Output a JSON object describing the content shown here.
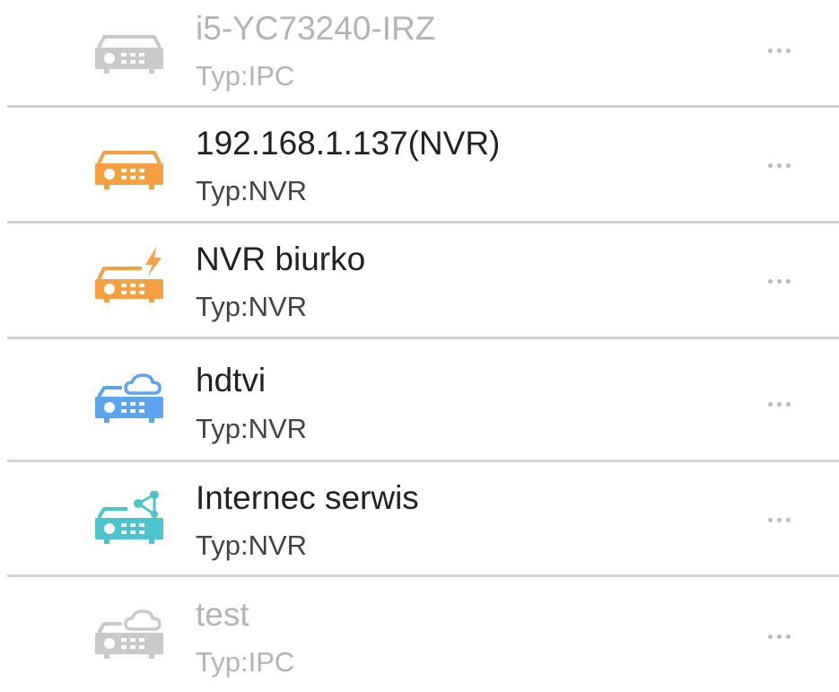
{
  "colors": {
    "active_text": "#222222",
    "type_text": "#444444",
    "inactive_text": "#b4b4b4",
    "inactive_icon": "#c9c9c9",
    "nvr_orange": "#f7a042",
    "cloud_blue": "#5aa5ee",
    "share_teal": "#4cc4cf",
    "divider": "#d2d2d2"
  },
  "devices": [
    {
      "name": "i5-YC73240-IRZ",
      "type": "Typ:IPC",
      "icon": "dvr-gray-icon",
      "state": "inactive"
    },
    {
      "name": "192.168.1.137(NVR)",
      "type": "Typ:NVR",
      "icon": "dvr-orange-icon",
      "state": "active"
    },
    {
      "name": "NVR biurko",
      "type": "Typ:NVR",
      "icon": "dvr-lightning-icon",
      "state": "active"
    },
    {
      "name": "hdtvi",
      "type": "Typ:NVR",
      "icon": "dvr-cloud-icon",
      "state": "active"
    },
    {
      "name": "Internec serwis",
      "type": "Typ:NVR",
      "icon": "dvr-share-icon",
      "state": "active"
    },
    {
      "name": "test",
      "type": "Typ:IPC",
      "icon": "dvr-cloud-gray-icon",
      "state": "inactive"
    }
  ]
}
